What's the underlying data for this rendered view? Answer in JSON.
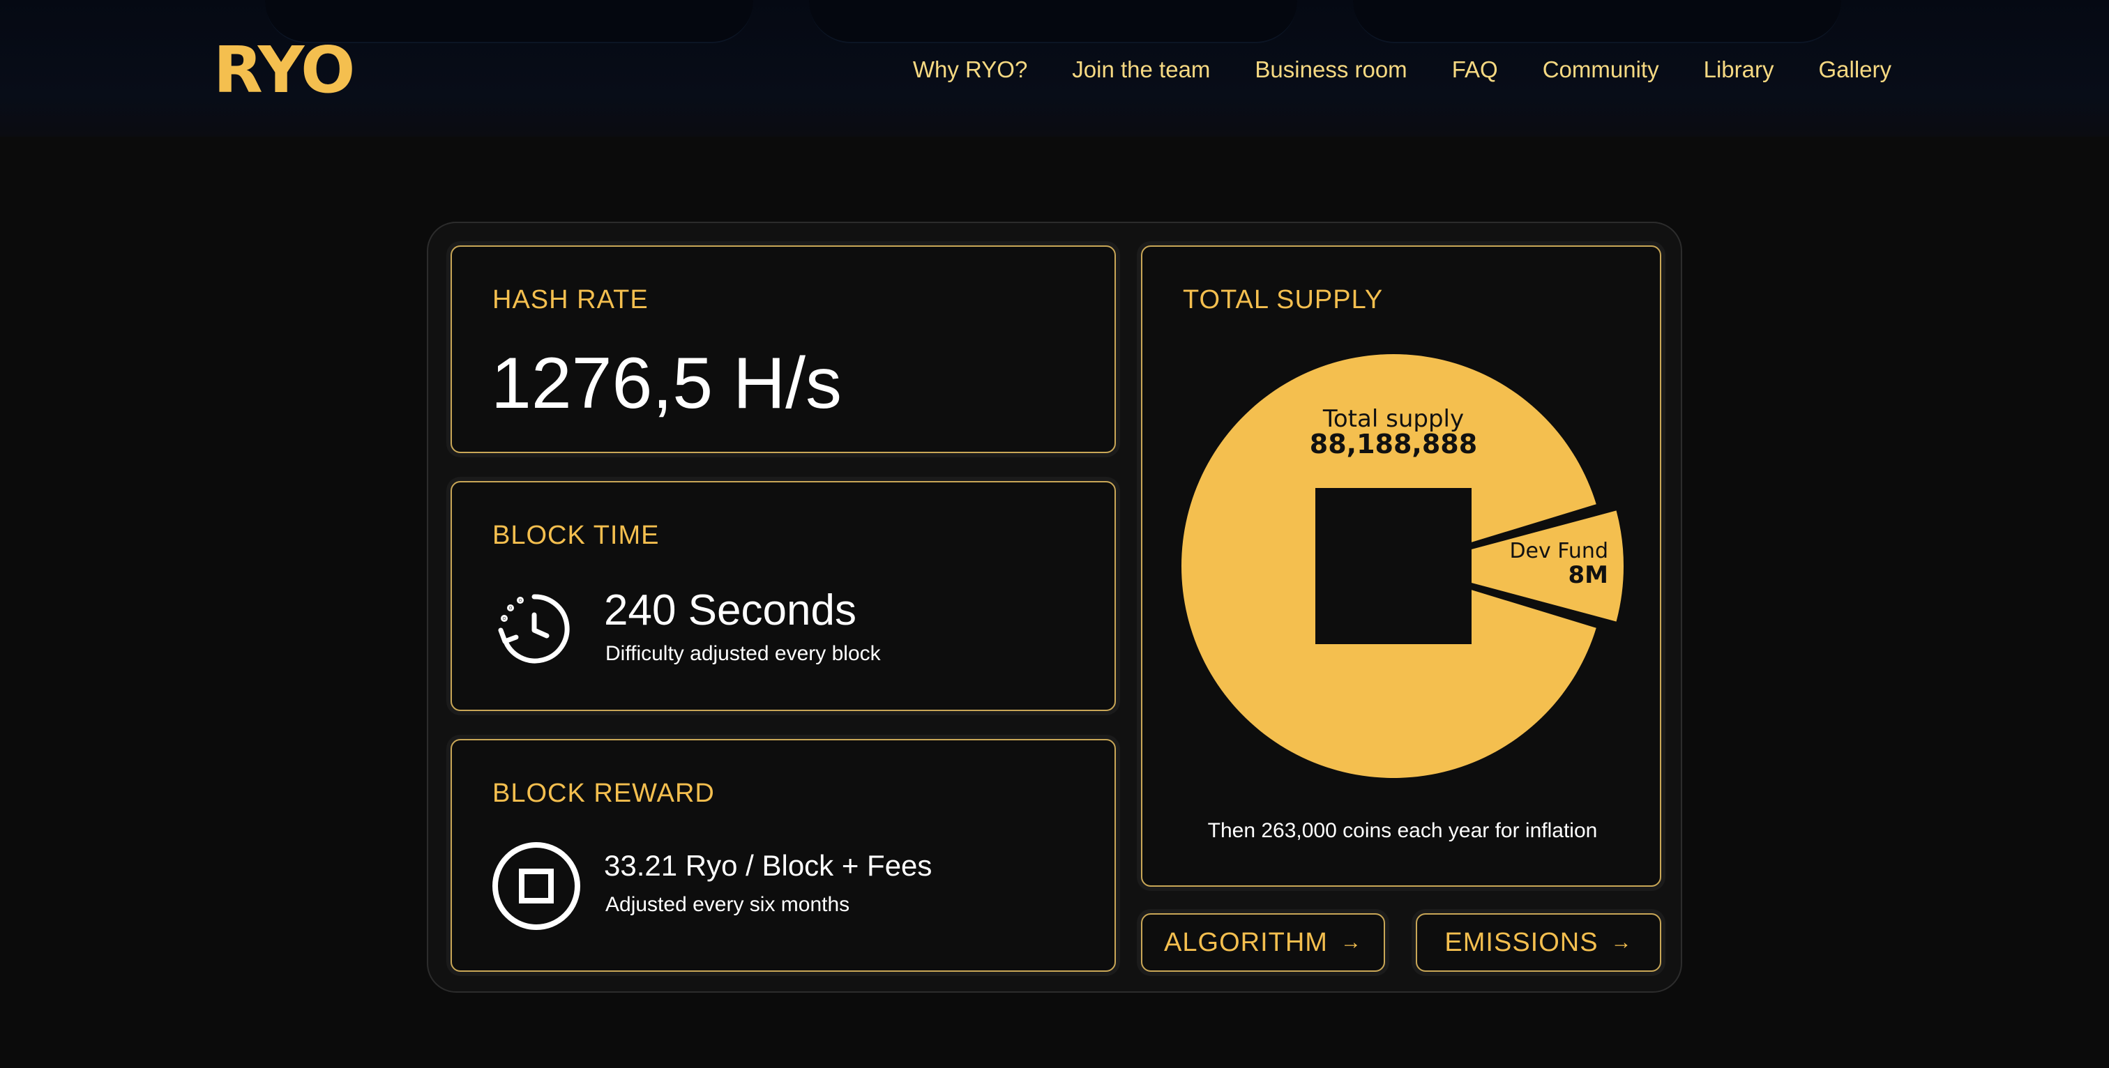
{
  "brand": {
    "logo": "RYO",
    "accent": "#f4bf4f"
  },
  "nav": {
    "items": [
      "Why RYO?",
      "Join the team",
      "Business room",
      "FAQ",
      "Community",
      "Library",
      "Gallery"
    ]
  },
  "hash_rate": {
    "title": "HASH RATE",
    "value": "1276,5 H/s"
  },
  "block_time": {
    "title": "BLOCK TIME",
    "value": "240 Seconds",
    "subtitle": "Difficulty adjusted every block",
    "icon": "clock-refresh-icon"
  },
  "block_reward": {
    "title": "BLOCK REWARD",
    "value": "33.21 Ryo / Block + Fees",
    "subtitle": "Adjusted every six months",
    "icon": "coin-icon"
  },
  "total_supply": {
    "title": "TOTAL SUPPLY",
    "note": "Then 263,000 coins each year for inflation"
  },
  "buttons": {
    "algorithm": "ALGORITHM",
    "emissions": "EMISSIONS",
    "arrow": "→"
  },
  "chart_data": {
    "type": "pie",
    "slices": [
      {
        "label": "Total supply",
        "value_label": "88,188,888",
        "value": 88188888,
        "color": "#f4bf4f"
      },
      {
        "label": "Dev Fund",
        "value_label": "8M",
        "value": 8000000,
        "color": "#f4bf4f"
      }
    ]
  }
}
